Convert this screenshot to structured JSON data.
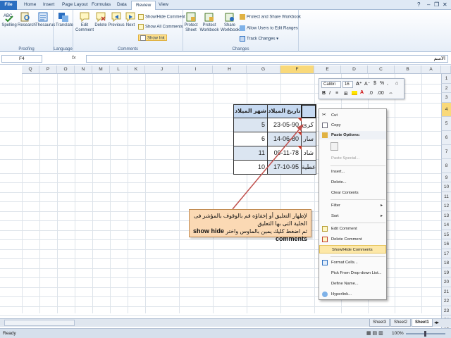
{
  "tabs": [
    "File",
    "Home",
    "Insert",
    "Page Layout",
    "Formulas",
    "Data",
    "Review",
    "View"
  ],
  "active_tab": "Review",
  "ribbon": {
    "proofing": {
      "name": "Proofing",
      "spelling": "Spelling",
      "research": "Research",
      "thesaurus": "Thesaurus"
    },
    "language": {
      "name": "Language",
      "translate": "Translate"
    },
    "comments": {
      "name": "Comments",
      "edit": "Edit Comment",
      "delete": "Delete",
      "previous": "Previous",
      "next": "Next",
      "show_hide": "Show/Hide Comment",
      "show_all": "Show All Comments",
      "show_ink": "Show Ink"
    },
    "changes": {
      "name": "Changes",
      "protect_sheet": "Protect Sheet",
      "protect_workbook": "Protect Workbook",
      "share_workbook": "Share Workbook",
      "protect_share": "Protect and Share Workbook",
      "allow_users": "Allow Users to Edit Ranges",
      "track_changes": "Track Changes"
    }
  },
  "formula_bar": {
    "name_box": "F4",
    "fx": "fx",
    "content": "الاسم"
  },
  "columns": [
    "A",
    "B",
    "C",
    "D",
    "E",
    "F",
    "G",
    "H",
    "I",
    "J",
    "K",
    "L",
    "M",
    "N",
    "O",
    "P",
    "Q"
  ],
  "rows": [
    "1",
    "2",
    "3",
    "4",
    "5",
    "6",
    "7",
    "8",
    "9",
    "10",
    "11",
    "12",
    "13",
    "14",
    "15",
    "16",
    "17",
    "18",
    "19",
    "20",
    "21",
    "22",
    "23",
    "24",
    "25"
  ],
  "table": {
    "headers": [
      "شهر الميلاد",
      "تاريخ الميلاد"
    ],
    "rows": [
      {
        "month": "5",
        "date": "23-05-90",
        "name": "كرى"
      },
      {
        "month": "6",
        "date": "14-06-80",
        "name": "سار"
      },
      {
        "month": "11",
        "date": "09-11-78",
        "name": "شاد"
      },
      {
        "month": "10",
        "date": "17-10-95",
        "name": "عطية"
      }
    ]
  },
  "mini_toolbar": {
    "font": "Calibri",
    "size": "16",
    "currency": "$",
    "percent": "%"
  },
  "context_menu": {
    "cut": "Cut",
    "copy": "Copy",
    "paste_options": "Paste Options:",
    "paste_special": "Paste Special...",
    "insert": "Insert...",
    "delete": "Delete...",
    "clear_contents": "Clear Contents",
    "filter": "Filter",
    "sort": "Sort",
    "edit_comment": "Edit Comment",
    "delete_comment": "Delete Comment",
    "show_hide_comments": "Show/Hide Comments",
    "format_cells": "Format Cells...",
    "pick_dropdown": "Pick From Drop-down List...",
    "define_name": "Define Name...",
    "hyperlink": "Hyperlink..."
  },
  "callout": {
    "line1": "لإظهار التعليق أو إخفاؤه قم بالوقوف بالمؤشر فى الخلية التى بها التعليق",
    "line2": "ثم اضغط كليك يمين بالماوس واختر",
    "command": "show hide comments"
  },
  "sheet_tabs": [
    "Sheet3",
    "Sheet2",
    "Sheet1"
  ],
  "status": {
    "ready": "Ready",
    "zoom": "100%"
  },
  "colors": {
    "accent": "#2a6ec0",
    "highlight": "#fde8a8",
    "callout": "#fbd9b4",
    "arrow": "#c0504d"
  }
}
